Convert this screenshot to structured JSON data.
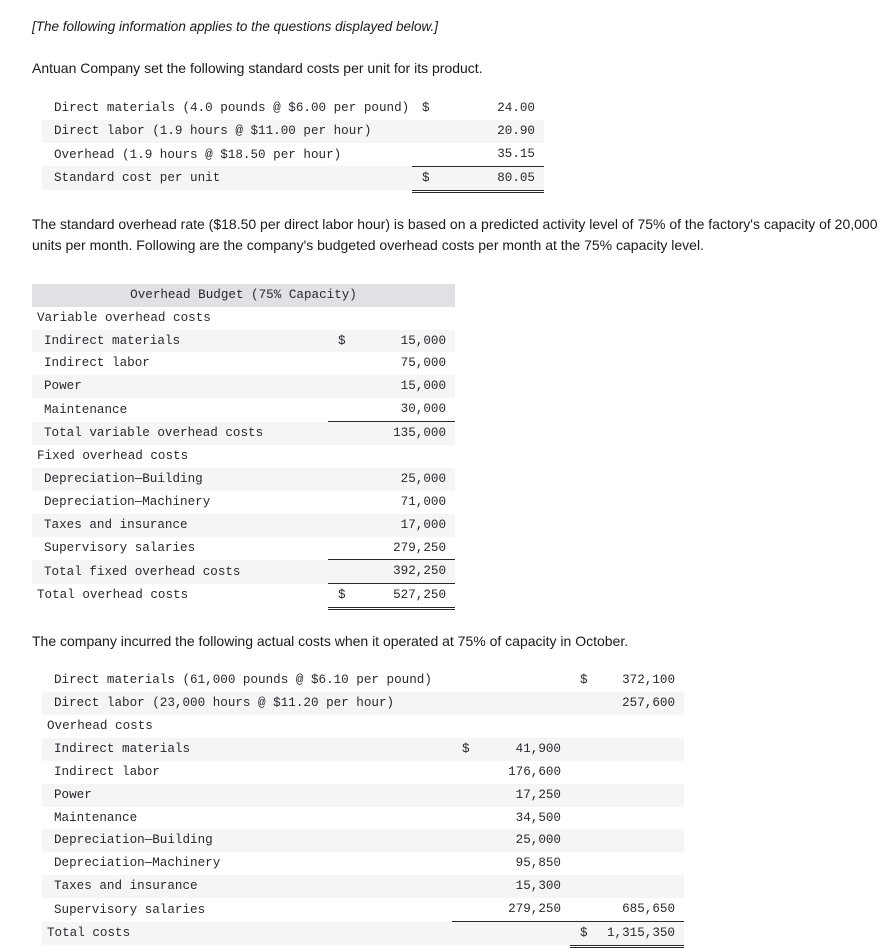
{
  "intro": {
    "note": "[The following information applies to the questions displayed below.]",
    "lead_paragraph": "Antuan Company set the following standard costs per unit for its product."
  },
  "standard_cost_table": {
    "name": "Standard cost per unit",
    "rows": [
      {
        "label": "Direct materials (4.0 pounds @ $6.00 per pound)",
        "currency": "$",
        "amount": "24.00"
      },
      {
        "label": "Direct labor (1.9 hours @ $11.00 per hour)",
        "currency": "",
        "amount": "20.90"
      },
      {
        "label": "Overhead (1.9 hours @ $18.50 per hour)",
        "currency": "",
        "amount": "35.15"
      },
      {
        "label": "Standard cost per unit",
        "currency": "$",
        "amount": "80.05"
      }
    ]
  },
  "overhead_rate_paragraph": "The standard overhead rate ($18.50 per direct labor hour) is based on a predicted activity level of 75% of the factory's capacity of 20,000 units per month. Following are the company's budgeted overhead costs per month at the 75% capacity level.",
  "overhead_budget_table": {
    "header": "Overhead Budget (75% Capacity)",
    "variable_section_label": "Variable overhead costs",
    "variable_rows": [
      {
        "label": "Indirect materials",
        "currency": "$",
        "amount": "15,000"
      },
      {
        "label": "Indirect labor",
        "currency": "",
        "amount": "75,000"
      },
      {
        "label": "Power",
        "currency": "",
        "amount": "15,000"
      },
      {
        "label": "Maintenance",
        "currency": "",
        "amount": "30,000"
      }
    ],
    "variable_total": {
      "label": "Total variable overhead costs",
      "currency": "",
      "amount": "135,000"
    },
    "fixed_section_label": "Fixed overhead costs",
    "fixed_rows": [
      {
        "label": "Depreciation—Building",
        "currency": "",
        "amount": "25,000"
      },
      {
        "label": "Depreciation—Machinery",
        "currency": "",
        "amount": "71,000"
      },
      {
        "label": "Taxes and insurance",
        "currency": "",
        "amount": "17,000"
      },
      {
        "label": "Supervisory salaries",
        "currency": "",
        "amount": "279,250"
      }
    ],
    "fixed_total": {
      "label": "Total fixed overhead costs",
      "currency": "",
      "amount": "392,250"
    },
    "grand_total": {
      "label": "Total overhead costs",
      "currency": "$",
      "amount": "527,250"
    }
  },
  "actual_costs_paragraph": "The company incurred the following actual costs when it operated at 75% of capacity in October.",
  "actual_costs_table": {
    "name": "Actual costs",
    "direct_rows": [
      {
        "label": "Direct materials (61,000 pounds @ $6.10 per pound)",
        "currency": "$",
        "amount": "372,100"
      },
      {
        "label": "Direct labor (23,000 hours @ $11.20 per hour)",
        "currency": "",
        "amount": "257,600"
      }
    ],
    "overhead_section_label": "Overhead costs",
    "overhead_rows": [
      {
        "label": "Indirect materials",
        "currency": "$",
        "amount": "41,900"
      },
      {
        "label": "Indirect labor",
        "currency": "",
        "amount": "176,600"
      },
      {
        "label": "Power",
        "currency": "",
        "amount": "17,250"
      },
      {
        "label": "Maintenance",
        "currency": "",
        "amount": "34,500"
      },
      {
        "label": "Depreciation—Building",
        "currency": "",
        "amount": "25,000"
      },
      {
        "label": "Depreciation—Machinery",
        "currency": "",
        "amount": "95,850"
      },
      {
        "label": "Taxes and insurance",
        "currency": "",
        "amount": "15,300"
      },
      {
        "label": "Supervisory salaries",
        "currency": "",
        "amount": "279,250",
        "outer_currency": "",
        "outer_amount": "685,650"
      }
    ],
    "total_row": {
      "label": "Total costs",
      "outer_currency": "$",
      "outer_amount": "1,315,350"
    }
  }
}
